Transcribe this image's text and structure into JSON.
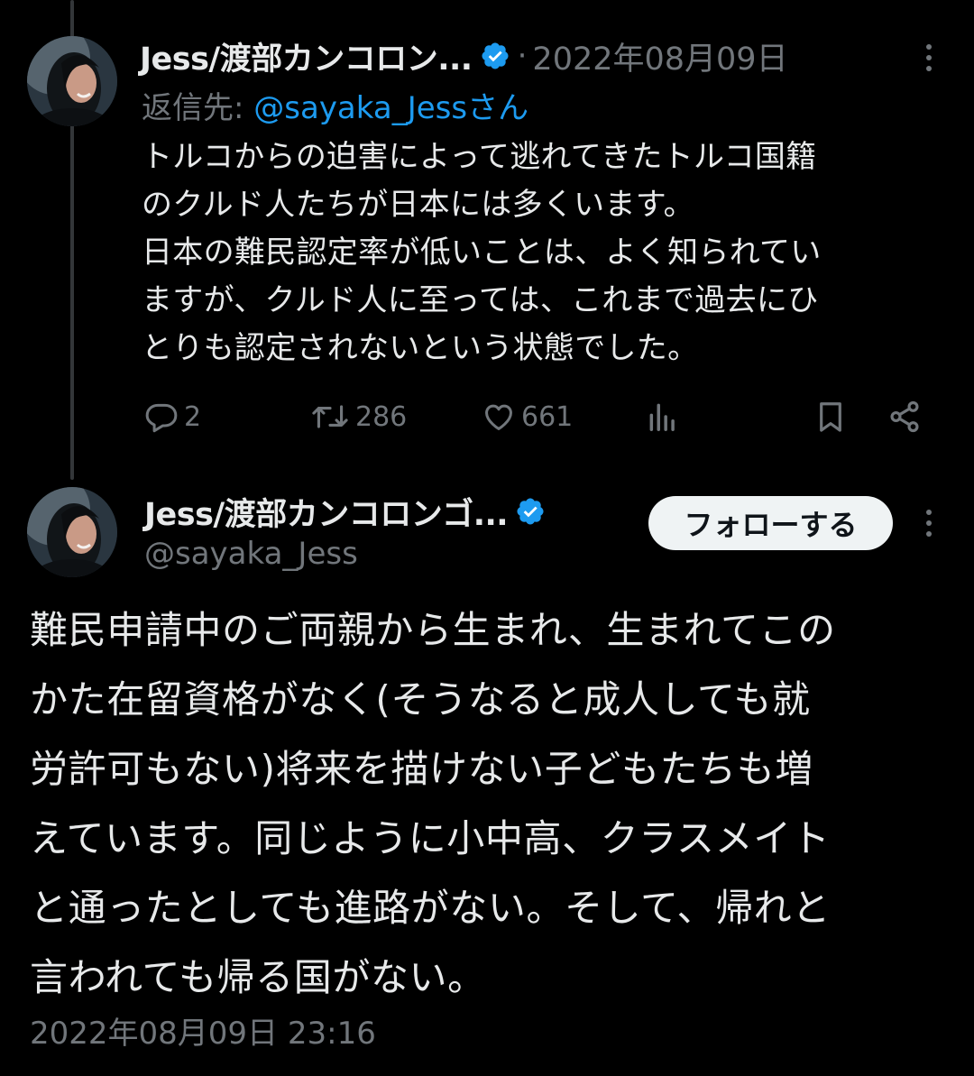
{
  "post1": {
    "display_name": "Jess/渡部カンコロン...",
    "date": "2022年08月09日",
    "separator": "·",
    "reply_label": "返信先: ",
    "reply_mention": "@sayaka_Jessさん",
    "text": "トルコからの迫害によって逃れてきたトルコ国籍\nのクルド人たちが日本には多くいます。\n日本の難民認定率が低いことは、よく知られてい\nますが、クルド人に至っては、これまで過去にひ\nとりも認定されないという状態でした。",
    "replies": "2",
    "retweets": "286",
    "likes": "661"
  },
  "post2": {
    "display_name": "Jess/渡部カンコロンゴ...",
    "handle": "@sayaka_Jess",
    "follow_label": "フォローする",
    "text": "難民申請中のご両親から生まれ、生まれてこの\nかた在留資格がなく(そうなると成人しても就\n労許可もない)将来を描けない子どもたちも増\nえています。同じように小中高、クラスメイト\nと通ったとしても進路がない。そして、帰れと\n言われても帰る国がない。",
    "timestamp": "2022年08月09日 23:16"
  },
  "icons": [
    "avatar",
    "verified-badge-icon",
    "more-options-icon",
    "reply-icon",
    "retweet-icon",
    "like-icon",
    "views-icon",
    "bookmark-icon",
    "share-icon"
  ],
  "colors": {
    "background": "#000000",
    "text_primary": "#e7e9ea",
    "text_secondary": "#71767b",
    "accent": "#1d9bf0",
    "follow_bg": "#eff3f4"
  }
}
